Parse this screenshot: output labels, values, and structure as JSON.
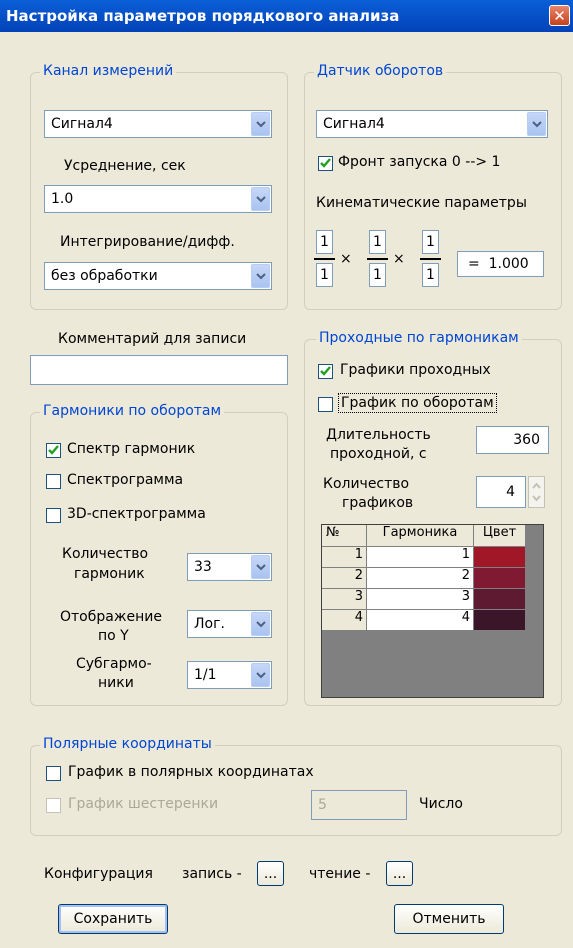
{
  "window": {
    "title": "Настройка параметров порядкового анализа"
  },
  "channel": {
    "group_title": "Канал измерений",
    "signal_value": "Сигнал4",
    "averaging_label": "Усреднение, сек",
    "averaging_value": "1.0",
    "integration_label": "Интегрирование/дифф.",
    "integration_value": "без обработки"
  },
  "tacho": {
    "group_title": "Датчик оборотов",
    "signal_value": "Сигнал4",
    "front_label": "Фронт запуска 0 --> 1",
    "front_checked": true,
    "kinematic_label": "Кинематические параметры",
    "fractions": [
      {
        "num": "1",
        "den": "1"
      },
      {
        "num": "1",
        "den": "1"
      },
      {
        "num": "1",
        "den": "1"
      }
    ],
    "times": "×",
    "result": "=  1.000"
  },
  "comment": {
    "label": "Комментарий для записи",
    "value": ""
  },
  "harmonics": {
    "group_title": "Гармоники по оборотам",
    "options": [
      {
        "label": "Спектр гармоник",
        "checked": true
      },
      {
        "label": "Спектрограмма",
        "checked": false
      },
      {
        "label": "3D-спектрограмма",
        "checked": false
      }
    ],
    "count_label_1": "Количество",
    "count_label_2": "гармоник",
    "count_value": "33",
    "display_label_1": "Отображение",
    "display_label_2": "по Y",
    "display_value": "Лог.",
    "sub_label_1": "Субгармо-",
    "sub_label_2": "ники",
    "sub_value": "1/1"
  },
  "runup": {
    "group_title": "Проходные по гармоникам",
    "graphs_label": "Графики проходных",
    "graphs_checked": true,
    "rpm_label": "График по оборотам",
    "rpm_checked": false,
    "duration_label_1": "Длительность",
    "duration_label_2": "проходной, с",
    "duration_value": "360",
    "count_label_1": "Количество",
    "count_label_2": "графиков",
    "count_value": "4",
    "table": {
      "headers": [
        "№",
        "Гармоника",
        "Цвет"
      ],
      "rows": [
        {
          "n": "1",
          "harmonic": "1",
          "color": "#a01828"
        },
        {
          "n": "2",
          "harmonic": "2",
          "color": "#801a32"
        },
        {
          "n": "3",
          "harmonic": "3",
          "color": "#5e1a30"
        },
        {
          "n": "4",
          "harmonic": "4",
          "color": "#3a1628"
        }
      ]
    }
  },
  "polar": {
    "group_title": "Полярные координаты",
    "polar_label": "График в полярных координатах",
    "polar_checked": false,
    "gear_label": "График шестеренки",
    "gear_value": "5",
    "number_label": "Число"
  },
  "config": {
    "label": "Конфигурация",
    "write_label": "запись -",
    "read_label": "чтение -",
    "browse_label": "..."
  },
  "buttons": {
    "save": "Сохранить",
    "cancel": "Отменить"
  },
  "colors": {
    "title_bar": "#0342b8",
    "group_title": "#0046d5",
    "background": "#ece9d8"
  }
}
